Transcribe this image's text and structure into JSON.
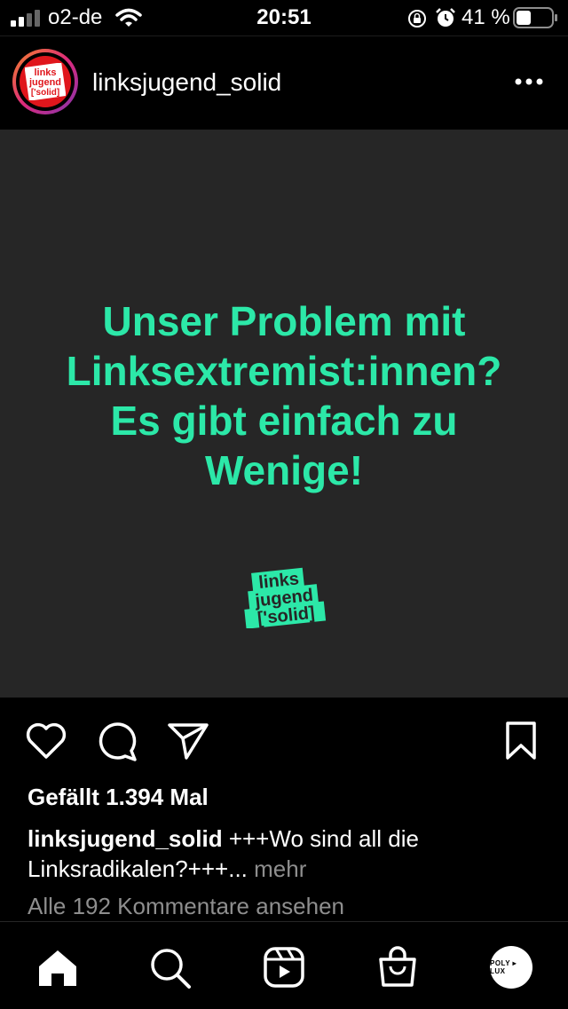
{
  "status_bar": {
    "carrier": "o2-de",
    "time": "20:51",
    "battery_percent": "41 %",
    "battery_level": 0.41,
    "icons": [
      "signal-icon",
      "wifi-icon",
      "orientation-lock-icon",
      "alarm-icon",
      "battery-icon"
    ]
  },
  "header": {
    "username": "linksjugend_solid",
    "avatar_logo_lines": [
      "links",
      "jugend",
      "['solid]"
    ],
    "more_icon": "more-horizontal-icon"
  },
  "post": {
    "headline": "Unser Problem mit\nLinksextremist:innen?\nEs gibt einfach zu\nWenige!",
    "logo_lines": [
      "links",
      "jugend",
      "['solid]"
    ],
    "accent_color": "#2ce8a8",
    "background_color": "#262626"
  },
  "actions": {
    "icons": [
      "heart-icon",
      "comment-icon",
      "share-icon",
      "bookmark-icon"
    ]
  },
  "likes_text": "Gefällt 1.394 Mal",
  "caption": {
    "username": "linksjugend_solid",
    "text": " +++Wo sind all die Linksradikalen?+++...",
    "more_label": " mehr"
  },
  "comments_link": "Alle 192 Kommentare ansehen",
  "tab_bar": {
    "items": [
      "home-icon",
      "search-icon",
      "reels-icon",
      "shop-icon",
      "profile-avatar"
    ],
    "profile_avatar_text": "POLY ▸ LUX"
  }
}
